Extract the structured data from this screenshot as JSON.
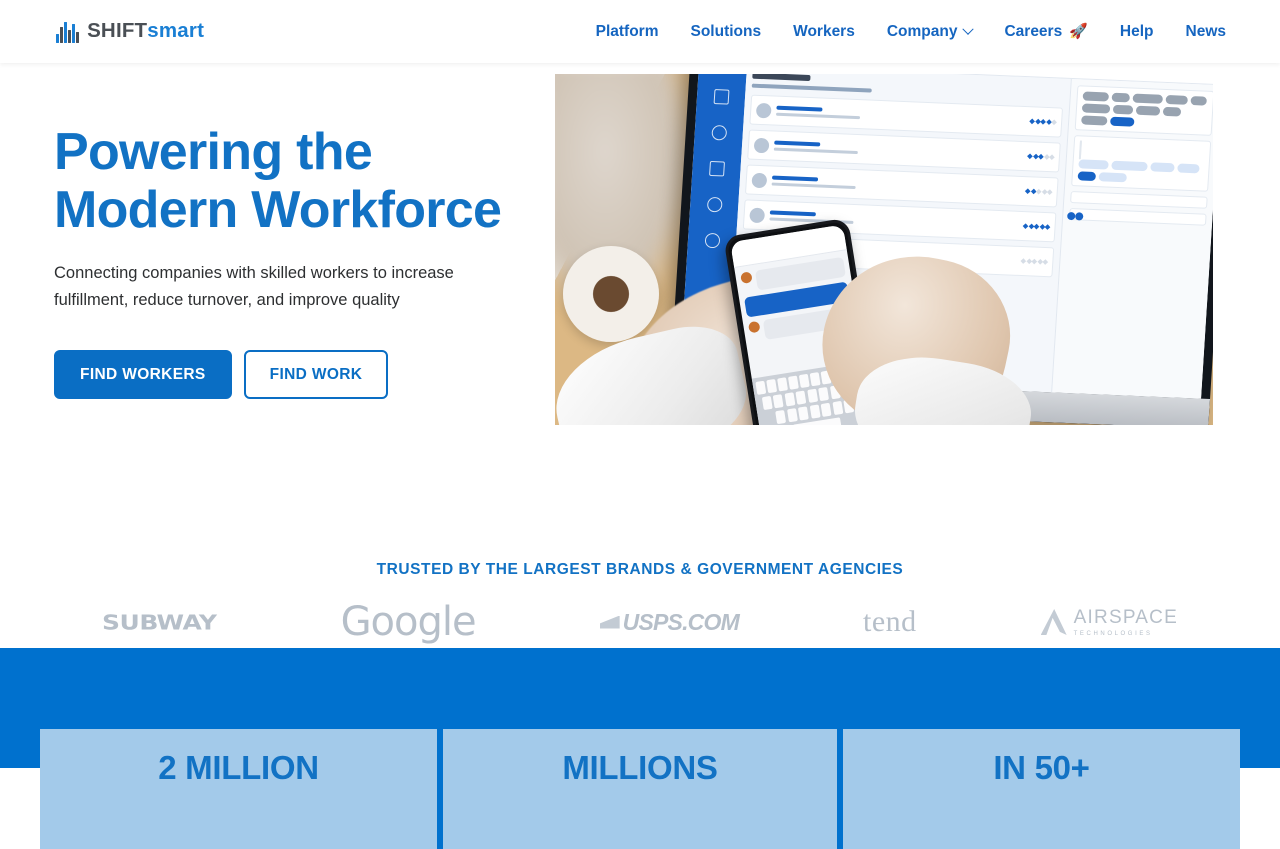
{
  "header": {
    "logo": {
      "icon": "shiftsmart-bars-logo-icon",
      "text_primary": "SHIFT",
      "text_secondary": "smart"
    },
    "nav": [
      {
        "label": "Platform",
        "icon": null
      },
      {
        "label": "Solutions",
        "icon": null
      },
      {
        "label": "Workers",
        "icon": null
      },
      {
        "label": "Company",
        "icon": "chevron-down-icon"
      },
      {
        "label": "Careers",
        "icon": "rocket-emoji",
        "emoji": "🚀"
      },
      {
        "label": "Help",
        "icon": null
      },
      {
        "label": "News",
        "icon": null
      }
    ]
  },
  "hero": {
    "title_line1": "Powering the",
    "title_line2": "Modern Workforce",
    "subtitle": "Connecting companies with skilled workers to increase fulfillment, reduce turnover, and improve quality",
    "primary_button": "FIND WORKERS",
    "secondary_button": "FIND WORK",
    "image_alt": "Person using phone next to laptop showing Shiftsmart partner pool dashboard"
  },
  "trusted": {
    "title": "TRUSTED BY THE LARGEST BRANDS & GOVERNMENT AGENCIES",
    "brands": [
      {
        "name": "SUBWAY"
      },
      {
        "name": "Google"
      },
      {
        "name": "USPS.COM"
      },
      {
        "name": "tend"
      },
      {
        "name": "AIRSPACE",
        "sub": "TECHNOLOGIES"
      }
    ]
  },
  "stats": {
    "items": [
      {
        "value": "2 MILLION"
      },
      {
        "value": "MILLIONS"
      },
      {
        "value": "IN 50+"
      }
    ]
  },
  "colors": {
    "brand_blue": "#0071ce",
    "link_blue": "#1565c0",
    "heading_blue": "#1272c4",
    "button_blue": "#0a6ec4",
    "stat_card_blue": "#a3caea",
    "logo_dark": "#4a4f55",
    "brand_logo_gray": "#b6bfc9"
  }
}
